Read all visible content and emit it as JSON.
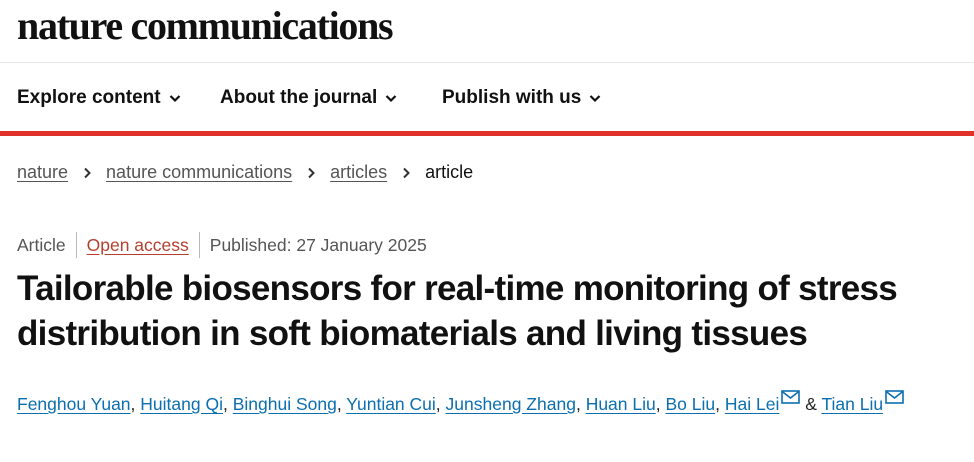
{
  "header": {
    "logo": "nature communications"
  },
  "nav": {
    "items": [
      {
        "label": "Explore content"
      },
      {
        "label": "About the journal"
      },
      {
        "label": "Publish with us"
      }
    ]
  },
  "breadcrumb": {
    "items": [
      "nature",
      "nature communications",
      "articles"
    ],
    "current": "article"
  },
  "article": {
    "type": "Article",
    "access": "Open access",
    "published": "Published: 27 January 2025",
    "title": "Tailorable biosensors for real-time monitoring of stress distribution in soft biomaterials and living tissues",
    "authors": [
      "Fenghou Yuan",
      "Huitang Qi",
      "Binghui Song",
      "Yuntian Cui",
      "Junsheng Zhang",
      "Huan Liu",
      "Bo Liu",
      "Hai Lei",
      "Tian Liu"
    ],
    "author_separator": ",",
    "author_last_joiner": "&"
  },
  "colors": {
    "accent": "#e0312a",
    "link": "#0b6fb0",
    "open_access": "#b5402e",
    "muted": "#555555"
  },
  "icons": {
    "nav_chevron": "chevron-down-icon",
    "breadcrumb_separator": "chevron-right-icon",
    "corresponding_author": "mail-icon"
  }
}
